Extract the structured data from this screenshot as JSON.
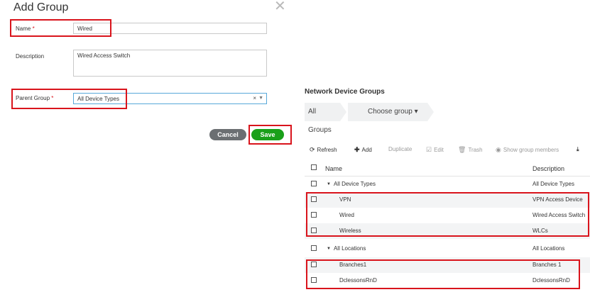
{
  "dialog": {
    "title": "Add Group",
    "close_icon": "close-icon",
    "name_label": "Name",
    "required_mark": "*",
    "name_value": "Wired",
    "description_label": "Description",
    "description_value": "Wired Access Switch",
    "parent_label": "Parent Group",
    "parent_value": "All Device Types",
    "clear_glyph": "×",
    "cancel_label": "Cancel",
    "save_label": "Save"
  },
  "panel": {
    "title": "Network Device Groups",
    "breadcrumb_all": "All Groups",
    "breadcrumb_choose": "Choose group ▾",
    "toolbar": {
      "refresh": "Refresh",
      "add": "Add",
      "duplicate": "Duplicate",
      "edit": "Edit",
      "trash": "Trash",
      "show_members": "Show group members"
    },
    "columns": {
      "name": "Name",
      "description": "Description"
    },
    "rows": [
      {
        "name": "All Device Types",
        "description": "All Device Types"
      },
      {
        "name": "VPN",
        "description": "VPN Access Device"
      },
      {
        "name": "Wired",
        "description": "Wired Access Switch"
      },
      {
        "name": "Wireless",
        "description": "WLCs"
      },
      {
        "name": "All Locations",
        "description": "All Locations"
      },
      {
        "name": "Branches1",
        "description": "Branches 1"
      },
      {
        "name": "DclessonsRnD",
        "description": "DclessonsRnD"
      }
    ]
  },
  "colors": {
    "highlight": "#d9141c",
    "save": "#1aa01a",
    "cancel": "#6b6f72",
    "focus": "#58a9d9"
  }
}
